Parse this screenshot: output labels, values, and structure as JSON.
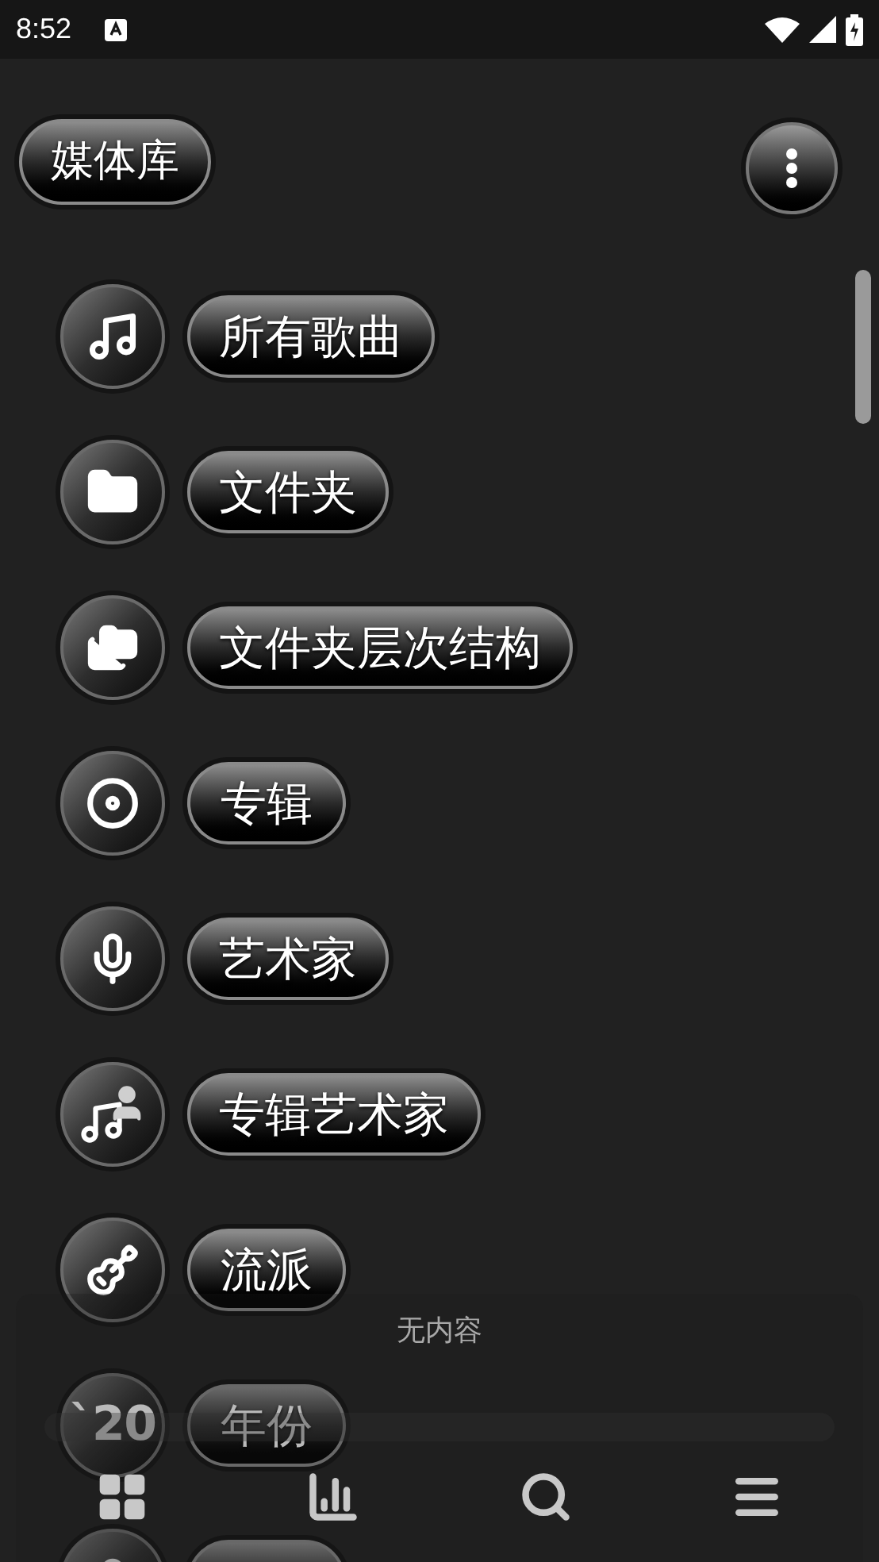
{
  "status_bar": {
    "time": "8:52"
  },
  "header": {
    "title": "媒体库"
  },
  "library_items": [
    {
      "kind": "songs",
      "label": "所有歌曲"
    },
    {
      "kind": "folder",
      "label": "文件夹"
    },
    {
      "kind": "folders",
      "label": "文件夹层次结构"
    },
    {
      "kind": "album",
      "label": "专辑"
    },
    {
      "kind": "artist",
      "label": "艺术家"
    },
    {
      "kind": "album_artist",
      "label": "专辑艺术家"
    },
    {
      "kind": "genre",
      "label": "流派"
    },
    {
      "kind": "year",
      "label": "年份",
      "icon_text": "`20"
    },
    {
      "kind": "composer"
    }
  ],
  "mini_player": {
    "message": "无内容"
  },
  "bottom_nav": [
    {
      "kind": "grid"
    },
    {
      "kind": "chart"
    },
    {
      "kind": "search"
    },
    {
      "kind": "menu"
    }
  ]
}
